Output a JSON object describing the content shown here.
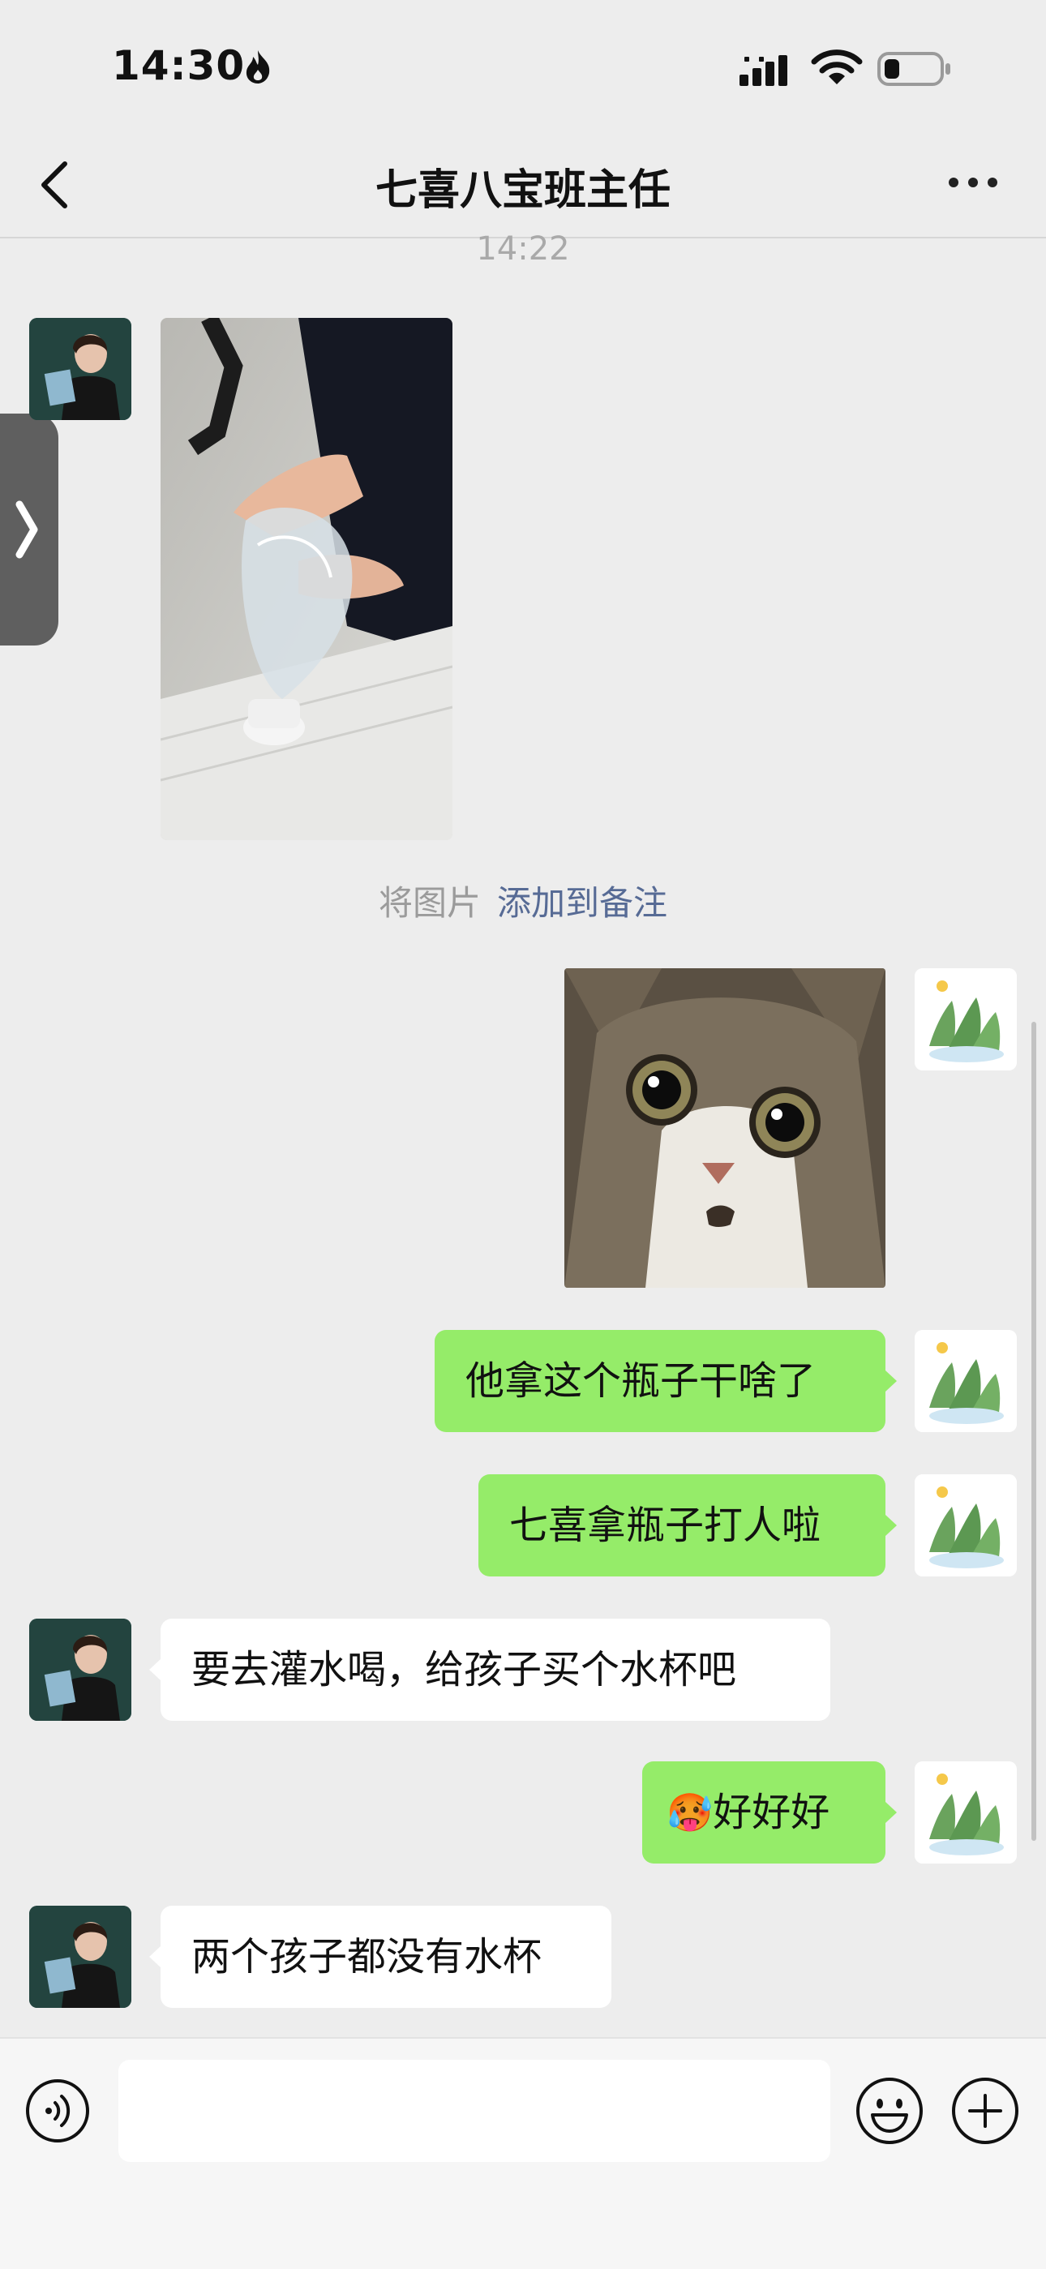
{
  "status_bar": {
    "time": "14:30"
  },
  "header": {
    "title": "七喜八宝班主任"
  },
  "timestamp": "14:22",
  "note": {
    "prefix": "将图片",
    "link": "添加到备注"
  },
  "messages": [
    {
      "side": "left",
      "type": "image",
      "content": "water-bottle-photo"
    },
    {
      "side": "right",
      "type": "image",
      "content": "startled-cat-photo"
    },
    {
      "side": "right",
      "type": "text",
      "text": "他拿这个瓶子干啥了"
    },
    {
      "side": "right",
      "type": "text",
      "text": "七喜拿瓶子打人啦"
    },
    {
      "side": "left",
      "type": "text",
      "text": "要去灌水喝，给孩子买个水杯吧"
    },
    {
      "side": "right",
      "type": "text",
      "text": "好好好",
      "emoji": "🥵"
    },
    {
      "side": "left",
      "type": "text",
      "text": "两个孩子都没有水杯"
    }
  ],
  "input": {
    "value": "",
    "placeholder": ""
  },
  "colors": {
    "self_bubble": "#95ec69",
    "other_bubble": "#ffffff",
    "link": "#576b95",
    "background": "#ededed"
  },
  "icons": [
    "flame-icon",
    "signal-icon",
    "wifi-icon",
    "battery-icon",
    "back-arrow-icon",
    "more-dots-icon",
    "voice-icon",
    "emoji-icon",
    "plus-icon"
  ]
}
